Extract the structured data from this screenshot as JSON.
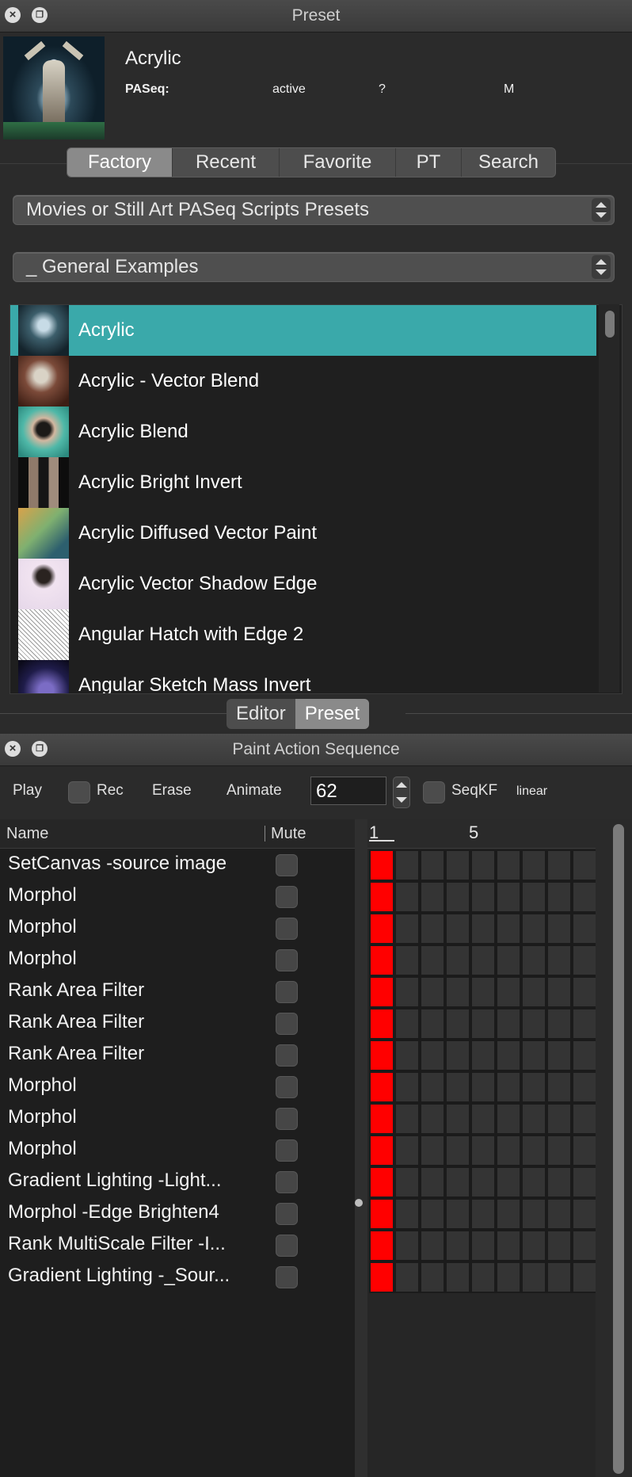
{
  "preset_window": {
    "title": "Preset",
    "preset_name": "Acrylic",
    "meta_label": "PASeq:",
    "meta_status": "active",
    "meta_q": "?",
    "meta_m": "M",
    "tabs": [
      "Factory",
      "Recent",
      "Favorite",
      "PT",
      "Search"
    ],
    "active_tab": "Factory",
    "category_dropdown": "Movies or Still Art PASeq Scripts Presets",
    "subcategory_dropdown": "_ General Examples",
    "presets": [
      "Acrylic",
      "Acrylic - Vector Blend",
      "Acrylic Blend",
      "Acrylic Bright Invert",
      "Acrylic Diffused Vector Paint",
      "Acrylic Vector Shadow Edge",
      "Angular Hatch with Edge 2",
      "Angular Sketch Mass Invert"
    ],
    "selected_preset": "Acrylic",
    "view_switch": [
      "Editor",
      "Preset"
    ],
    "active_view": "Preset"
  },
  "pas_window": {
    "title": "Paint Action Sequence",
    "toolbar": {
      "play": "Play",
      "rec": "Rec",
      "erase": "Erase",
      "animate": "Animate",
      "frame_value": "62",
      "seqkf": "SeqKF",
      "interp": "linear"
    },
    "columns": {
      "name": "Name",
      "mute": "Mute"
    },
    "steps": [
      "SetCanvas -source image",
      "Morphol",
      "Morphol",
      "Morphol",
      "Rank Area Filter",
      "Rank Area Filter",
      "Rank Area Filter",
      "Morphol",
      "Morphol",
      "Morphol",
      "Gradient Lighting -Light...",
      "Morphol -Edge Brighten4",
      "Rank MultiScale Filter -I...",
      "Gradient Lighting -_Sour..."
    ],
    "timeline_labels": [
      "1",
      "5"
    ],
    "keyframe_color": "#ff0000",
    "selection_color": "#3aa9aa"
  }
}
